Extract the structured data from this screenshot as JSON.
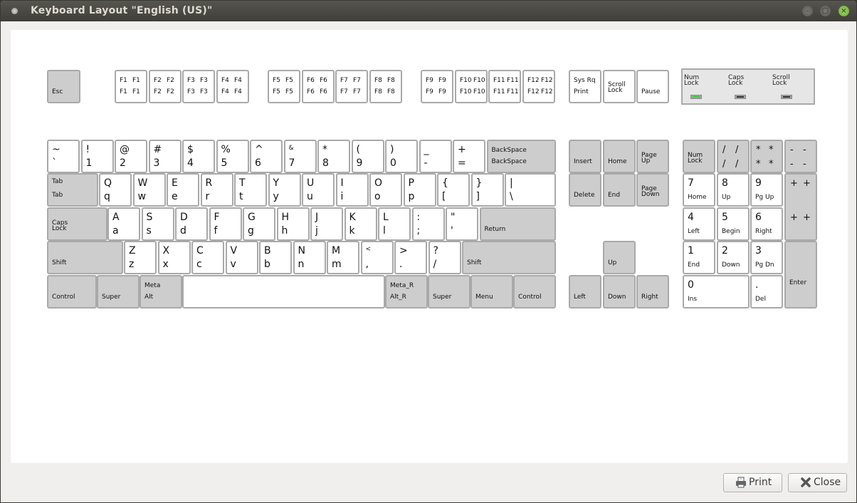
{
  "window": {
    "title": "Keyboard Layout \"English (US)\"",
    "controls": {
      "minimize": "minimize-icon",
      "maximize": "maximize-icon",
      "close": "close-icon"
    }
  },
  "colors": {
    "key_face": "#ffffff",
    "modifier_key": "#cdcdcd",
    "key_border": "#a9a9a9",
    "led_on": "#35d435",
    "led_off": "#333333",
    "title_bar": "#4a4944"
  },
  "function_row": {
    "esc": {
      "label": "Esc"
    },
    "fkeys": [
      {
        "label": "F1"
      },
      {
        "label": "F2"
      },
      {
        "label": "F3"
      },
      {
        "label": "F4"
      },
      {
        "label": "F5"
      },
      {
        "label": "F6"
      },
      {
        "label": "F7"
      },
      {
        "label": "F8"
      },
      {
        "label": "F9"
      },
      {
        "label": "F10"
      },
      {
        "label": "F11"
      },
      {
        "label": "F12"
      }
    ],
    "sysrq": {
      "top": "Sys Rq",
      "bottom": "Print"
    },
    "scroll_lock": {
      "label": "Scroll\nLock"
    },
    "pause": {
      "label": "Pause"
    }
  },
  "leds": [
    {
      "label": "Num\nLock",
      "state": "on"
    },
    {
      "label": "Caps\nLock",
      "state": "off"
    },
    {
      "label": "Scroll\nLock",
      "state": "off"
    }
  ],
  "main_rows": {
    "row1": [
      {
        "top": "~",
        "bottom": "`"
      },
      {
        "top": "!",
        "bottom": "1"
      },
      {
        "top": "@",
        "bottom": "2"
      },
      {
        "top": "#",
        "bottom": "3"
      },
      {
        "top": "$",
        "bottom": "4"
      },
      {
        "top": "%",
        "bottom": "5"
      },
      {
        "top": "^",
        "bottom": "6"
      },
      {
        "top": "&",
        "bottom": "7"
      },
      {
        "top": "*",
        "bottom": "8"
      },
      {
        "top": "(",
        "bottom": "9"
      },
      {
        "top": ")",
        "bottom": "0"
      },
      {
        "top": "_",
        "bottom": "-"
      },
      {
        "top": "+",
        "bottom": "="
      }
    ],
    "backspace": {
      "top": "BackSpace",
      "bottom": "BackSpace"
    },
    "tab": {
      "top": "Tab",
      "bottom": "Tab"
    },
    "row2": [
      {
        "top": "Q",
        "bottom": "q"
      },
      {
        "top": "W",
        "bottom": "w"
      },
      {
        "top": "E",
        "bottom": "e"
      },
      {
        "top": "R",
        "bottom": "r"
      },
      {
        "top": "T",
        "bottom": "t"
      },
      {
        "top": "Y",
        "bottom": "y"
      },
      {
        "top": "U",
        "bottom": "u"
      },
      {
        "top": "I",
        "bottom": "i"
      },
      {
        "top": "O",
        "bottom": "o"
      },
      {
        "top": "P",
        "bottom": "p"
      },
      {
        "top": "{",
        "bottom": "["
      },
      {
        "top": "}",
        "bottom": "]"
      },
      {
        "top": "|",
        "bottom": "\\"
      }
    ],
    "caps_lock": {
      "label": "Caps\nLock"
    },
    "row3": [
      {
        "top": "A",
        "bottom": "a"
      },
      {
        "top": "S",
        "bottom": "s"
      },
      {
        "top": "D",
        "bottom": "d"
      },
      {
        "top": "F",
        "bottom": "f"
      },
      {
        "top": "G",
        "bottom": "g"
      },
      {
        "top": "H",
        "bottom": "h"
      },
      {
        "top": "J",
        "bottom": "j"
      },
      {
        "top": "K",
        "bottom": "k"
      },
      {
        "top": "L",
        "bottom": "l"
      },
      {
        "top": ":",
        "bottom": ";"
      },
      {
        "top": "\"",
        "bottom": "'"
      }
    ],
    "return": {
      "label": "Return"
    },
    "shift_left": {
      "label": "Shift"
    },
    "row4": [
      {
        "top": "Z",
        "bottom": "z"
      },
      {
        "top": "X",
        "bottom": "x"
      },
      {
        "top": "C",
        "bottom": "c"
      },
      {
        "top": "V",
        "bottom": "v"
      },
      {
        "top": "B",
        "bottom": "b"
      },
      {
        "top": "N",
        "bottom": "n"
      },
      {
        "top": "M",
        "bottom": "m"
      },
      {
        "top": "<",
        "bottom": ","
      },
      {
        "top": ">",
        "bottom": "."
      },
      {
        "top": "?",
        "bottom": "/"
      }
    ],
    "shift_right": {
      "label": "Shift"
    },
    "row5": {
      "control_left": {
        "label": "Control"
      },
      "super_left": {
        "label": "Super"
      },
      "alt_left": {
        "top": "Meta",
        "bottom": "Alt"
      },
      "space": {
        "label": ""
      },
      "alt_right": {
        "top": "Meta_R",
        "bottom": "Alt_R"
      },
      "super_right": {
        "label": "Super"
      },
      "menu": {
        "label": "Menu"
      },
      "control_right": {
        "label": "Control"
      }
    }
  },
  "nav_cluster": {
    "insert": "Insert",
    "home": "Home",
    "page_up": "Page\nUp",
    "delete": "Delete",
    "end": "End",
    "page_down": "Page\nDown",
    "up": "Up",
    "left": "Left",
    "down": "Down",
    "right": "Right"
  },
  "numpad": {
    "num_lock": "Num\nLock",
    "divide": "/",
    "multiply": "*",
    "minus": "-",
    "plus": "+",
    "keys": [
      {
        "top": "7",
        "bottom": "Home"
      },
      {
        "top": "8",
        "bottom": "Up"
      },
      {
        "top": "9",
        "bottom": "Pg Up"
      },
      {
        "top": "4",
        "bottom": "Left"
      },
      {
        "top": "5",
        "bottom": "Begin"
      },
      {
        "top": "6",
        "bottom": "Right"
      },
      {
        "top": "1",
        "bottom": "End"
      },
      {
        "top": "2",
        "bottom": "Down"
      },
      {
        "top": "3",
        "bottom": "Pg Dn"
      },
      {
        "top": "0",
        "bottom": "Ins"
      },
      {
        "top": ".",
        "bottom": "Del"
      }
    ],
    "enter": "Enter"
  },
  "footer": {
    "print_button": {
      "label": "Print",
      "icon": "printer-icon"
    },
    "close_button": {
      "label": "Close",
      "icon": "close-x-icon"
    }
  }
}
